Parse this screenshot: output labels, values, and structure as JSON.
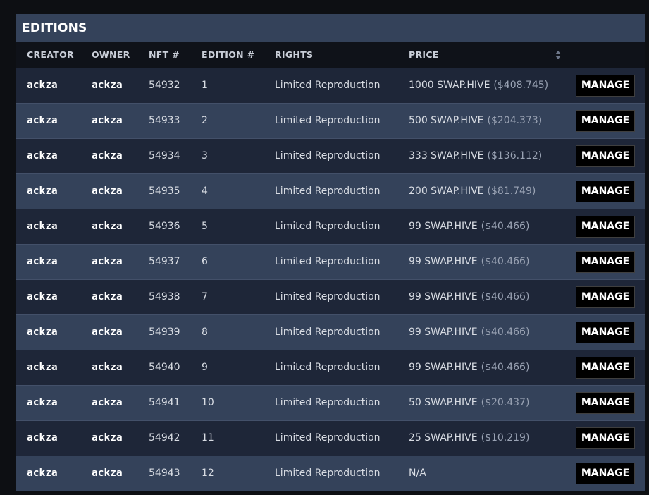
{
  "panel": {
    "title": "EDITIONS"
  },
  "table": {
    "headers": {
      "creator": "CREATOR",
      "owner": "OWNER",
      "nft": "NFT #",
      "edition": "EDITION #",
      "rights": "RIGHTS",
      "price": "PRICE"
    },
    "sort_icon": "sort-icon",
    "rows": [
      {
        "creator": "ackza",
        "owner": "ackza",
        "nft": "54932",
        "edition": "1",
        "rights": "Limited Reproduction",
        "price": "1000 SWAP.HIVE",
        "usd": "($408.745)",
        "action": "MANAGE"
      },
      {
        "creator": "ackza",
        "owner": "ackza",
        "nft": "54933",
        "edition": "2",
        "rights": "Limited Reproduction",
        "price": "500 SWAP.HIVE",
        "usd": "($204.373)",
        "action": "MANAGE"
      },
      {
        "creator": "ackza",
        "owner": "ackza",
        "nft": "54934",
        "edition": "3",
        "rights": "Limited Reproduction",
        "price": "333 SWAP.HIVE",
        "usd": "($136.112)",
        "action": "MANAGE"
      },
      {
        "creator": "ackza",
        "owner": "ackza",
        "nft": "54935",
        "edition": "4",
        "rights": "Limited Reproduction",
        "price": "200 SWAP.HIVE",
        "usd": "($81.749)",
        "action": "MANAGE"
      },
      {
        "creator": "ackza",
        "owner": "ackza",
        "nft": "54936",
        "edition": "5",
        "rights": "Limited Reproduction",
        "price": "99 SWAP.HIVE",
        "usd": "($40.466)",
        "action": "MANAGE"
      },
      {
        "creator": "ackza",
        "owner": "ackza",
        "nft": "54937",
        "edition": "6",
        "rights": "Limited Reproduction",
        "price": "99 SWAP.HIVE",
        "usd": "($40.466)",
        "action": "MANAGE"
      },
      {
        "creator": "ackza",
        "owner": "ackza",
        "nft": "54938",
        "edition": "7",
        "rights": "Limited Reproduction",
        "price": "99 SWAP.HIVE",
        "usd": "($40.466)",
        "action": "MANAGE"
      },
      {
        "creator": "ackza",
        "owner": "ackza",
        "nft": "54939",
        "edition": "8",
        "rights": "Limited Reproduction",
        "price": "99 SWAP.HIVE",
        "usd": "($40.466)",
        "action": "MANAGE"
      },
      {
        "creator": "ackza",
        "owner": "ackza",
        "nft": "54940",
        "edition": "9",
        "rights": "Limited Reproduction",
        "price": "99 SWAP.HIVE",
        "usd": "($40.466)",
        "action": "MANAGE"
      },
      {
        "creator": "ackza",
        "owner": "ackza",
        "nft": "54941",
        "edition": "10",
        "rights": "Limited Reproduction",
        "price": "50 SWAP.HIVE",
        "usd": "($20.437)",
        "action": "MANAGE"
      },
      {
        "creator": "ackza",
        "owner": "ackza",
        "nft": "54942",
        "edition": "11",
        "rights": "Limited Reproduction",
        "price": "25 SWAP.HIVE",
        "usd": "($10.219)",
        "action": "MANAGE"
      },
      {
        "creator": "ackza",
        "owner": "ackza",
        "nft": "54943",
        "edition": "12",
        "rights": "Limited Reproduction",
        "price": "N/A",
        "usd": "",
        "action": "MANAGE"
      }
    ]
  }
}
